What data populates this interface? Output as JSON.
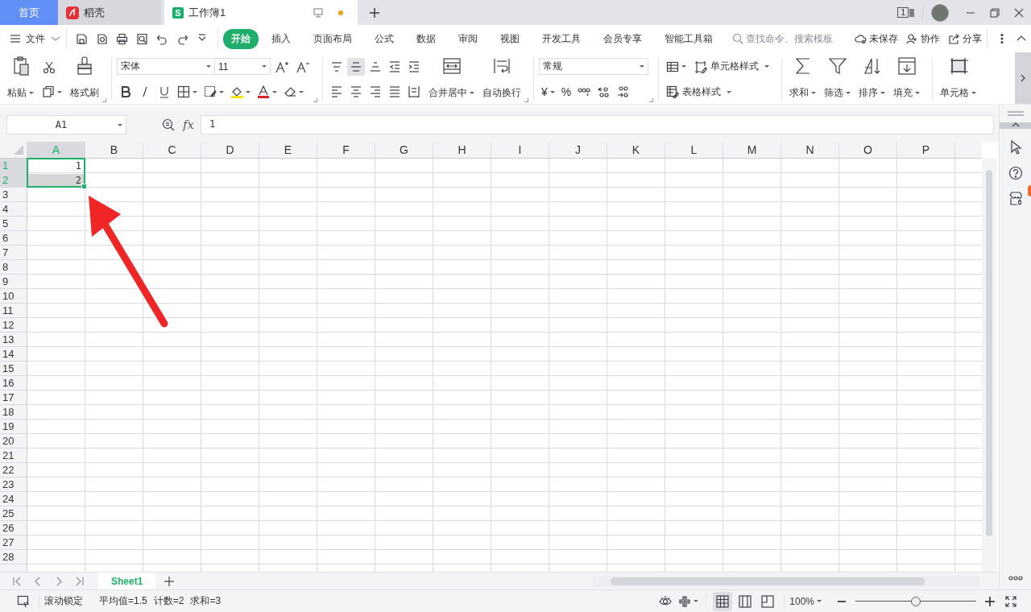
{
  "title_bar": {
    "tabs": [
      {
        "kind": "home",
        "label": "首页",
        "selected": false
      },
      {
        "kind": "docer",
        "label": "稻壳",
        "selected": false
      },
      {
        "kind": "workbook",
        "label": "工作簿1",
        "badge": "S",
        "selected": true,
        "unsaved": true
      }
    ],
    "window_count": "1"
  },
  "menu_bar": {
    "file": "文件",
    "tabs": [
      {
        "label": "开始",
        "selected": true
      },
      {
        "label": "插入",
        "selected": false
      },
      {
        "label": "页面布局",
        "selected": false
      },
      {
        "label": "公式",
        "selected": false
      },
      {
        "label": "数据",
        "selected": false
      },
      {
        "label": "审阅",
        "selected": false
      },
      {
        "label": "视图",
        "selected": false
      },
      {
        "label": "开发工具",
        "selected": false
      },
      {
        "label": "会员专享",
        "selected": false
      },
      {
        "label": "智能工具箱",
        "selected": false
      }
    ],
    "search": {
      "placeholder": "查找命令、搜索模板"
    },
    "actions": [
      {
        "kind": "cloud",
        "label": "未保存"
      },
      {
        "kind": "collab",
        "label": "协作"
      },
      {
        "kind": "share",
        "label": "分享"
      }
    ]
  },
  "ribbon": {
    "paste": "粘贴",
    "format_painter": "格式刷",
    "font": "宋体",
    "font_size": "11",
    "vertical_align": [
      {
        "kind": "top",
        "selected": false
      },
      {
        "kind": "middle",
        "selected": true
      },
      {
        "kind": "bottom",
        "selected": false
      }
    ],
    "merge": "合并居中",
    "wrap": "自动换行",
    "number_format": "常规",
    "currency": "¥",
    "percent": "%",
    "cell_style": "单元格样式",
    "table_style": "表格样式",
    "tools": [
      {
        "kind": "sum",
        "label": "求和"
      },
      {
        "kind": "filter",
        "label": "筛选"
      },
      {
        "kind": "sort",
        "label": "排序"
      },
      {
        "kind": "fill",
        "label": "填充"
      },
      {
        "kind": "cell",
        "label": "单元格"
      }
    ]
  },
  "formula_bar": {
    "name_box": "A1",
    "fx": "fx",
    "value": "1"
  },
  "sheet": {
    "columns": [
      {
        "label": "A",
        "selected": true
      },
      {
        "label": "B",
        "selected": false
      },
      {
        "label": "C",
        "selected": false
      },
      {
        "label": "D",
        "selected": false
      },
      {
        "label": "E",
        "selected": false
      },
      {
        "label": "F",
        "selected": false
      },
      {
        "label": "G",
        "selected": false
      },
      {
        "label": "H",
        "selected": false
      },
      {
        "label": "I",
        "selected": false
      },
      {
        "label": "J",
        "selected": false
      },
      {
        "label": "K",
        "selected": false
      },
      {
        "label": "L",
        "selected": false
      },
      {
        "label": "M",
        "selected": false
      },
      {
        "label": "N",
        "selected": false
      },
      {
        "label": "O",
        "selected": false
      },
      {
        "label": "P",
        "selected": false
      }
    ],
    "rows": [
      {
        "label": "1",
        "selected": true,
        "cells": [
          {
            "value": "1",
            "selected": true,
            "active": true
          }
        ]
      },
      {
        "label": "2",
        "selected": true,
        "cells": [
          {
            "value": "2",
            "selected": true,
            "active": false
          }
        ]
      },
      {
        "label": "3",
        "selected": false
      },
      {
        "label": "4",
        "selected": false
      },
      {
        "label": "5",
        "selected": false
      },
      {
        "label": "6",
        "selected": false
      },
      {
        "label": "7",
        "selected": false
      },
      {
        "label": "8",
        "selected": false
      },
      {
        "label": "9",
        "selected": false
      },
      {
        "label": "10",
        "selected": false
      },
      {
        "label": "11",
        "selected": false
      },
      {
        "label": "12",
        "selected": false
      },
      {
        "label": "13",
        "selected": false
      },
      {
        "label": "14",
        "selected": false
      },
      {
        "label": "15",
        "selected": false
      },
      {
        "label": "16",
        "selected": false
      },
      {
        "label": "17",
        "selected": false
      },
      {
        "label": "18",
        "selected": false
      },
      {
        "label": "19",
        "selected": false
      },
      {
        "label": "20",
        "selected": false
      },
      {
        "label": "21",
        "selected": false
      },
      {
        "label": "22",
        "selected": false
      },
      {
        "label": "23",
        "selected": false
      },
      {
        "label": "24",
        "selected": false
      },
      {
        "label": "25",
        "selected": false
      },
      {
        "label": "26",
        "selected": false
      },
      {
        "label": "27",
        "selected": false
      },
      {
        "label": "28",
        "selected": false
      }
    ]
  },
  "sheet_tabs": [
    {
      "label": "Sheet1",
      "selected": true
    }
  ],
  "status_bar": {
    "scroll_lock": "滚动锁定",
    "stats": [
      "平均值=1.5",
      "计数=2",
      "求和=3"
    ],
    "views": [
      {
        "kind": "normal",
        "selected": true
      },
      {
        "kind": "reading",
        "selected": false
      },
      {
        "kind": "page",
        "selected": false
      }
    ],
    "zoom": "100%",
    "zoom_slider": {
      "level": 0.5
    }
  }
}
